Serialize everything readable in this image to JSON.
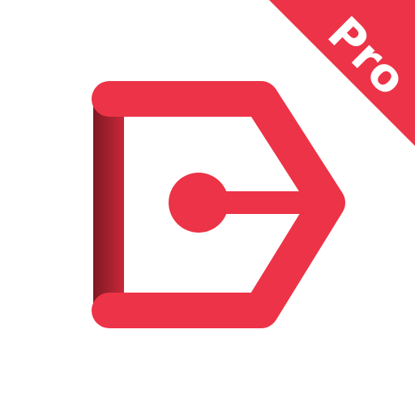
{
  "icon": {
    "name": "tag-pro-app-icon",
    "brand_color": "#ED3347",
    "shade_color": "#9E1F2D",
    "background_color": "#FFFFFF"
  },
  "ribbon": {
    "label": "Pro",
    "text_color": "#FFFFFF"
  }
}
